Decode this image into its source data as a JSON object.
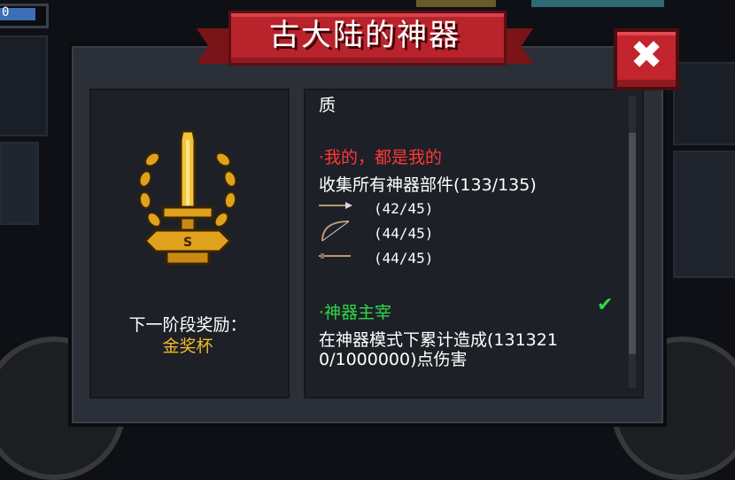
{
  "hud": {
    "value": "0"
  },
  "dialog": {
    "title": "古大陆的神器",
    "close_label": "✖"
  },
  "reward": {
    "label": "下一阶段奖励：",
    "value": "金奖杯"
  },
  "content": {
    "cut_line": "质",
    "achievements": [
      {
        "title": "·我的，都是我的",
        "desc": "收集所有神器部件(133/135)",
        "items": [
          {
            "icon": "spear-icon",
            "count": "(42/45)"
          },
          {
            "icon": "bow-icon",
            "count": "(44/45)"
          },
          {
            "icon": "staff-icon",
            "count": "(44/45)"
          }
        ],
        "color": "#ff3636"
      },
      {
        "title": "·神器主宰",
        "desc_line1": "在神器模式下累计造成(131321",
        "desc_line2": "0/1000000)点伤害",
        "completed": true,
        "color": "#2fd84a"
      }
    ]
  },
  "colors": {
    "ribbon": "#b9232b",
    "gold": "#f2b92a",
    "panel": "#1d2026"
  }
}
